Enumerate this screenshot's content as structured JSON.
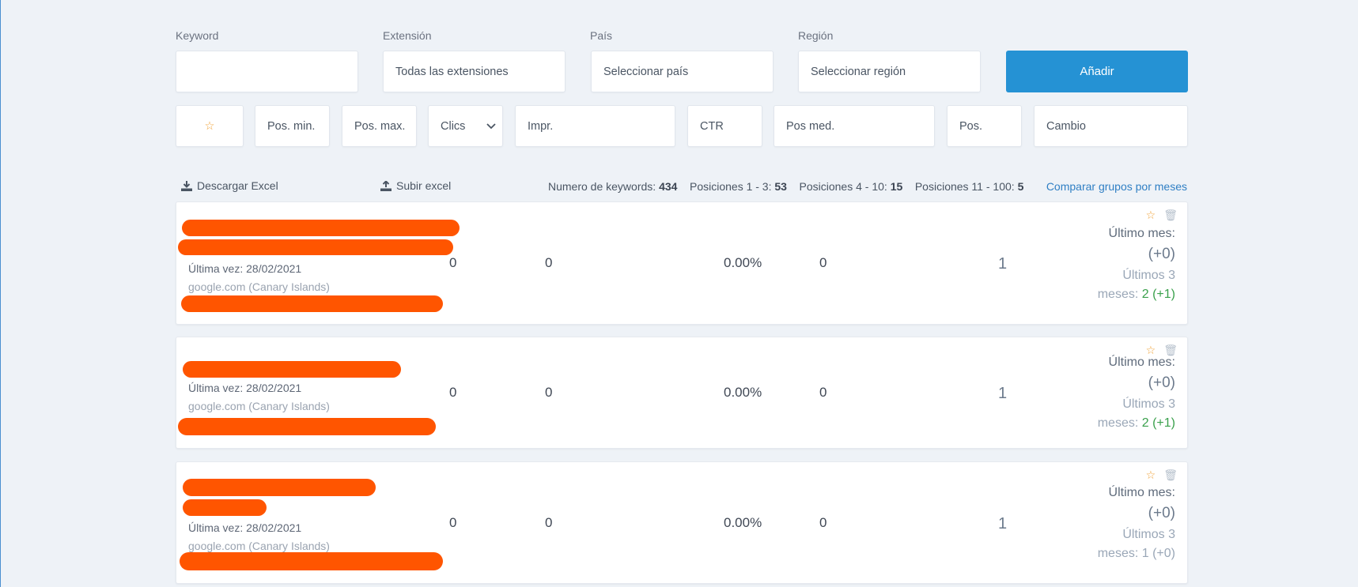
{
  "filters": {
    "keyword_label": "Keyword",
    "keyword_value": "",
    "extension_label": "Extensión",
    "extension_value": "Todas las extensiones",
    "country_label": "País",
    "country_value": "Seleccionar país",
    "region_label": "Región",
    "region_value": "Seleccionar región",
    "add_button": "Añadir"
  },
  "columns": {
    "star": "☆",
    "pos_min": "Pos. min.",
    "pos_max": "Pos. max.",
    "clicks": "Clics",
    "impr": "Impr.",
    "ctr": "CTR",
    "pos_med": "Pos med.",
    "pos": "Pos.",
    "change": "Cambio"
  },
  "toolbar": {
    "download": "Descargar Excel",
    "upload": "Subir excel",
    "kw_label": "Numero de keywords:",
    "kw_count": "434",
    "p13_label": "Posiciones 1 - 3:",
    "p13_count": "53",
    "p410_label": "Posiciones 4 - 10:",
    "p410_count": "15",
    "p11100_label": "Posiciones 11 - 100:",
    "p11100_count": "5",
    "compare_link": "Comparar grupos por meses"
  },
  "rows": [
    {
      "last_seen": "Última vez: 28/02/2021",
      "domain": "google.com (Canary Islands)",
      "clicks": "0",
      "impr": "0",
      "ctr": "0.00%",
      "pos_med": "0",
      "pos": "1",
      "last_month_label": "Último mes:",
      "last_month_change": "(+0)",
      "last3_label_a": "Últimos 3",
      "last3_label_b": "meses:",
      "last3_value": "2 (+1)"
    },
    {
      "last_seen": "Última vez: 28/02/2021",
      "domain": "google.com (Canary Islands)",
      "clicks": "0",
      "impr": "0",
      "ctr": "0.00%",
      "pos_med": "0",
      "pos": "1",
      "last_month_label": "Último mes:",
      "last_month_change": "(+0)",
      "last3_label_a": "Últimos 3",
      "last3_label_b": "meses:",
      "last3_value": "2 (+1)"
    },
    {
      "last_seen": "Última vez: 28/02/2021",
      "domain": "google.com (Canary Islands)",
      "clicks": "0",
      "impr": "0",
      "ctr": "0.00%",
      "pos_med": "0",
      "pos": "1",
      "last_month_label": "Último mes:",
      "last_month_change": "(+0)",
      "last3_label_a": "Últimos 3",
      "last3_label_b": "meses:",
      "last3_value": "1 (+0)"
    }
  ],
  "colors": {
    "accent": "#2592d4",
    "redaction": "#ff5500",
    "positive": "#3aa04c",
    "star": "#f0a33a"
  }
}
